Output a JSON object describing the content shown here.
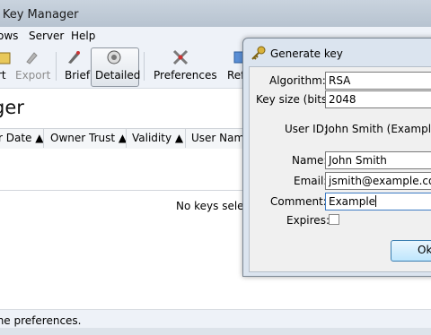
{
  "window": {
    "title": "- Key Manager"
  },
  "menubar": {
    "items": [
      "ows",
      "Server",
      "Help"
    ]
  },
  "toolbar": {
    "buttons": [
      {
        "label": "rt",
        "icon": "import-icon",
        "enabled": true
      },
      {
        "label": "Export",
        "icon": "export-icon",
        "enabled": false
      },
      {
        "label": "Brief",
        "icon": "brief-icon",
        "enabled": true
      },
      {
        "label": "Detailed",
        "icon": "detailed-icon",
        "enabled": true,
        "pressed": true
      },
      {
        "label": "Preferences",
        "icon": "preferences-icon",
        "enabled": true
      },
      {
        "label": "Ref",
        "icon": "refresh-icon",
        "enabled": true
      }
    ]
  },
  "main": {
    "heading": "ger",
    "columns": [
      "r Date",
      "Owner Trust",
      "Validity",
      "User Name"
    ],
    "empty_message": "No keys select"
  },
  "status": {
    "text": "the preferences."
  },
  "dialog": {
    "title": "Generate key",
    "algorithm": {
      "label": "Algorithm:",
      "value": "RSA"
    },
    "key_size": {
      "label": "Key size (bits):",
      "value": "2048"
    },
    "user_id": {
      "label": "User ID:",
      "value": "John Smith (Example)"
    },
    "name": {
      "label": "Name:",
      "value": "John Smith"
    },
    "email": {
      "label": "Email:",
      "value": "jsmith@example.com"
    },
    "comment": {
      "label": "Comment:",
      "value": "Example"
    },
    "expires": {
      "label": "Expires:",
      "checked": false
    },
    "ok_label": "Ok"
  },
  "colors": {
    "titlebar": "#bcc7d3",
    "dialog_frame": "#dbe4ef",
    "ok_button": "#bee6fd"
  }
}
